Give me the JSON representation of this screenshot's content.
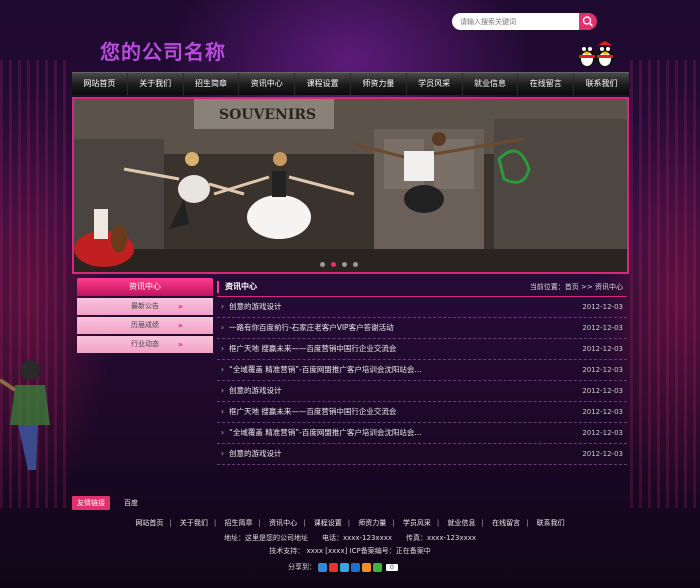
{
  "search": {
    "placeholder": "请输入搜索关键词"
  },
  "brand": {
    "name": "您的公司名称"
  },
  "nav": [
    {
      "label": "网站首页"
    },
    {
      "label": "关于我们"
    },
    {
      "label": "招生简章"
    },
    {
      "label": "资讯中心"
    },
    {
      "label": "课程设置"
    },
    {
      "label": "师资力量"
    },
    {
      "label": "学员风采"
    },
    {
      "label": "就业信息"
    },
    {
      "label": "在线留言"
    },
    {
      "label": "联系我们"
    }
  ],
  "banner": {
    "sign_text": "SOUVENIRS",
    "active_slide": 2,
    "slide_count": 4
  },
  "sidebar": {
    "title": "资讯中心",
    "items": [
      {
        "label": "最新公告"
      },
      {
        "label": "历届成绩"
      },
      {
        "label": "行业动态"
      }
    ],
    "arrow": "»"
  },
  "main": {
    "title": "资讯中心",
    "breadcrumb": "当前位置：首页 >> 资讯中心",
    "bullet": "›",
    "news": [
      {
        "title": "创意的游戏设计",
        "date": "2012-12-03"
      },
      {
        "title": "一路有你百度前行-石家庄老客户VIP客户答谢活动",
        "date": "2012-12-03"
      },
      {
        "title": "框广天地 搜赢未来——百度营销中国行企业交流会",
        "date": "2012-12-03"
      },
      {
        "title": "“全域覆盖 精准营销”-百度网盟推广客户培训会沈阳站会...",
        "date": "2012-12-03"
      },
      {
        "title": "创意的游戏设计",
        "date": "2012-12-03"
      },
      {
        "title": "框广天地 搜赢未来——百度营销中国行企业交流会",
        "date": "2012-12-03"
      },
      {
        "title": "“全域覆盖 精准营销”-百度网盟推广客户培训会沈阳站会...",
        "date": "2012-12-03"
      },
      {
        "title": "创意的游戏设计",
        "date": "2012-12-03"
      }
    ]
  },
  "friend_links": {
    "tag": "友情链接",
    "items": [
      {
        "label": "百度"
      }
    ]
  },
  "footer": {
    "nav": [
      {
        "label": "网站首页"
      },
      {
        "label": "关于我们"
      },
      {
        "label": "招生简章"
      },
      {
        "label": "资讯中心"
      },
      {
        "label": "课程设置"
      },
      {
        "label": "师资力量"
      },
      {
        "label": "学员风采"
      },
      {
        "label": "就业信息"
      },
      {
        "label": "在线留言"
      },
      {
        "label": "联系我们"
      }
    ],
    "separator": "|",
    "address": "地址：这里是您的公司地址　　电话：xxxx-123xxxx　　传真：xxxx-123xxxx",
    "support": "技术支持：  xxxx  [xxxx]  ICP备案编号：正在备案中",
    "share_label": "分享到：",
    "share_count": "0",
    "share_colors": [
      "#2d8ae0",
      "#e83030",
      "#33aadd",
      "#1f6fd0",
      "#f09020",
      "#43b043",
      "#2f80d8"
    ]
  }
}
